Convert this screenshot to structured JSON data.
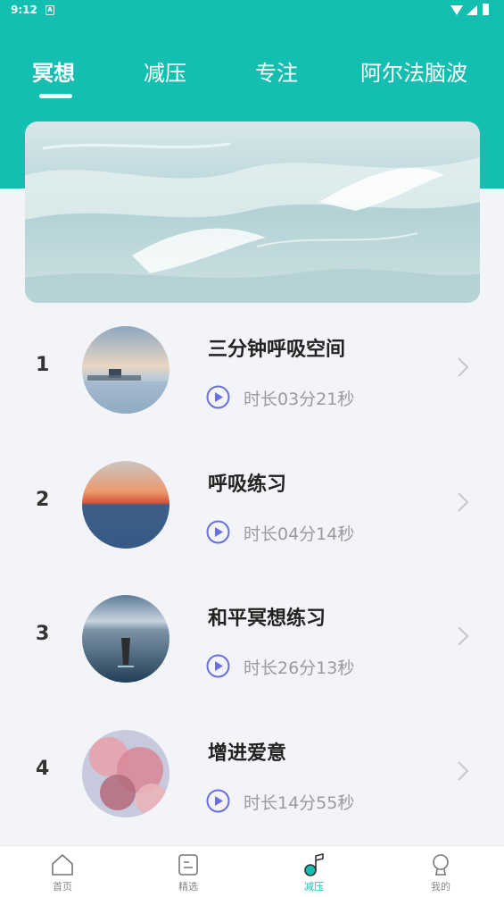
{
  "status_bar": {
    "time": "9:12",
    "notification": "A"
  },
  "tabs": [
    {
      "label": "冥想",
      "active": true
    },
    {
      "label": "减压",
      "active": false
    },
    {
      "label": "专注",
      "active": false
    },
    {
      "label": "阿尔法脑波",
      "active": false
    }
  ],
  "colors": {
    "accent": "#14bfb2",
    "play": "#6b6ee0",
    "background": "#f3f4f8"
  },
  "banner": {
    "image": "ocean-waves-photo"
  },
  "items": [
    {
      "rank": "1",
      "title": "三分钟呼吸空间",
      "duration": "时长03分21秒",
      "thumb": "misty-lake-house-photo"
    },
    {
      "rank": "2",
      "title": "呼吸练习",
      "duration": "时长04分14秒",
      "thumb": "sunset-sea-photo"
    },
    {
      "rank": "3",
      "title": "和平冥想练习",
      "duration": "时长26分13秒",
      "thumb": "boat-on-lake-photo"
    },
    {
      "rank": "4",
      "title": "增进爱意",
      "duration": "时长14分55秒",
      "thumb": "pink-clouds-photo"
    }
  ],
  "bottom_nav": [
    {
      "label": "首页",
      "icon": "home-icon",
      "active": false
    },
    {
      "label": "精选",
      "icon": "list-icon",
      "active": false
    },
    {
      "label": "减压",
      "icon": "music-note-icon",
      "active": true
    },
    {
      "label": "我的",
      "icon": "profile-icon",
      "active": false
    }
  ]
}
